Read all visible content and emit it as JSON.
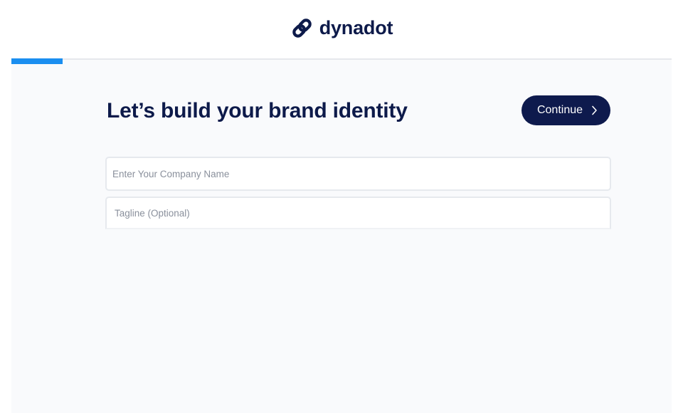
{
  "header": {
    "logo_text": "dynadot",
    "logo_icon": "chain-link-icon"
  },
  "progress": {
    "fraction": 0.078,
    "color": "#1a8ef0"
  },
  "main": {
    "title": "Let’s build your brand identity",
    "continue_label": "Continue",
    "continue_icon": "chevron-right-icon",
    "company_name": {
      "value": "",
      "placeholder": "Enter Your Company Name"
    },
    "tagline": {
      "value": "",
      "placeholder": "Tagline (Optional)"
    }
  },
  "colors": {
    "brand_navy": "#0d1a4a",
    "accent_blue": "#1a8ef0",
    "content_bg": "#f9fafc"
  }
}
